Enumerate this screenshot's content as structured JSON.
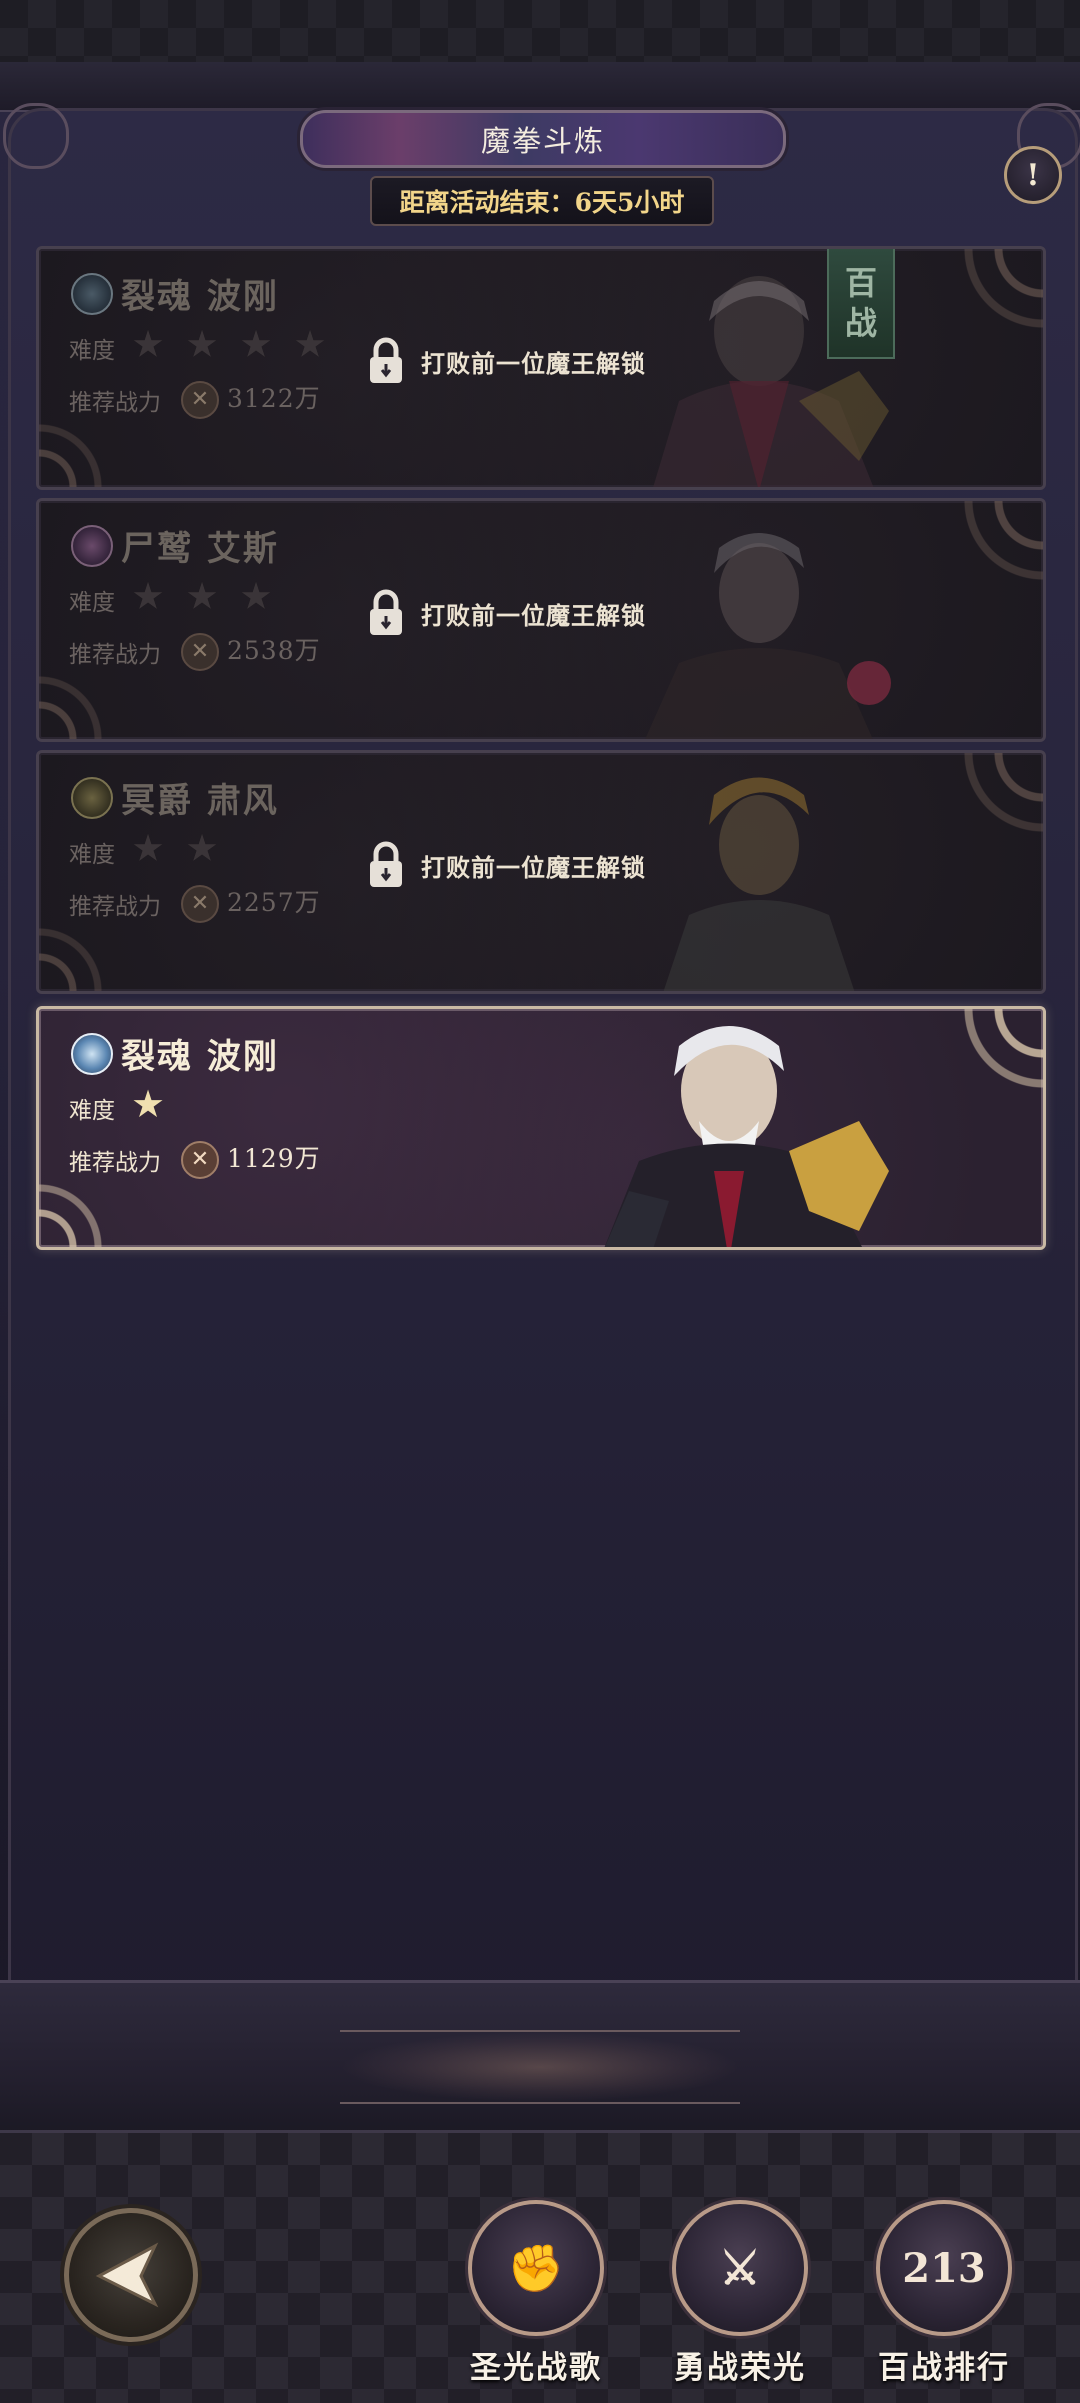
{
  "header": {
    "title": "魔拳斗炼",
    "countdown": "距离活动结束：6天5小时",
    "info_icon": "exclamation-icon"
  },
  "cards": [
    {
      "boss_name": "裂魂 波刚",
      "difficulty_label": "难度",
      "difficulty_stars": 4,
      "power_label": "推荐战力",
      "power_value": "3122万",
      "locked": true,
      "lock_text": "打败前一位魔王解锁",
      "tag_top": "百",
      "tag_bottom": "战"
    },
    {
      "boss_name": "尸鹫 艾斯",
      "difficulty_label": "难度",
      "difficulty_stars": 3,
      "power_label": "推荐战力",
      "power_value": "2538万",
      "locked": true,
      "lock_text": "打败前一位魔王解锁"
    },
    {
      "boss_name": "冥爵 肃风",
      "difficulty_label": "难度",
      "difficulty_stars": 2,
      "power_label": "推荐战力",
      "power_value": "2257万",
      "locked": true,
      "lock_text": "打败前一位魔王解锁"
    },
    {
      "boss_name": "裂魂 波刚",
      "difficulty_label": "难度",
      "difficulty_stars": 1,
      "power_label": "推荐战力",
      "power_value": "1129万",
      "locked": false
    }
  ],
  "bottom_nav": {
    "back_icon": "back-arrow-icon",
    "items": [
      {
        "label": "圣光战歌",
        "icon": "fist-emblem-icon"
      },
      {
        "label": "勇战荣光",
        "icon": "sword-wings-emblem-icon"
      },
      {
        "label": "百战排行",
        "icon": "skull-rank-emblem-icon",
        "emblem_text": "213"
      }
    ]
  },
  "colors": {
    "accent_gold": "#f2d58a",
    "active_border": "#c9b9a4",
    "background": "#27243b"
  }
}
